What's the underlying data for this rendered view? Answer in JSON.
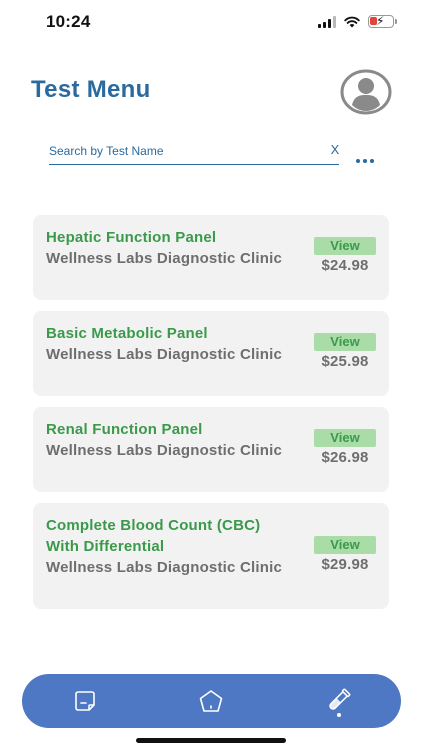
{
  "status_bar": {
    "time": "10:24",
    "icons": [
      "cellular-signal-icon",
      "wifi-icon",
      "battery-low-charging-icon"
    ],
    "battery_color": "#e0453a"
  },
  "header": {
    "title": "Test Menu",
    "avatar_icon": "user-avatar-icon"
  },
  "search": {
    "placeholder": "Search by Test Name",
    "value": "",
    "clear_label": "X",
    "more_icon": "more-dots-icon"
  },
  "tests": [
    {
      "name": "Hepatic Function Panel",
      "clinic": "Wellness Labs Diagnostic Clinic",
      "view_label": "View",
      "price": "$24.98"
    },
    {
      "name": "Basic Metabolic Panel",
      "clinic": "Wellness Labs Diagnostic Clinic",
      "view_label": "View",
      "price": "$25.98"
    },
    {
      "name": "Renal Function Panel",
      "clinic": "Wellness Labs Diagnostic Clinic",
      "view_label": "View",
      "price": "$26.98"
    },
    {
      "name": "Complete Blood Count (CBC) With Differential",
      "clinic": "Wellness Labs Diagnostic Clinic",
      "view_label": "View",
      "price": "$29.98"
    }
  ],
  "bottom_nav": {
    "items": [
      {
        "icon": "chat-document-icon",
        "active": false
      },
      {
        "icon": "home-pentagon-icon",
        "active": false
      },
      {
        "icon": "test-tube-icon",
        "active": true
      }
    ]
  },
  "colors": {
    "title": "#2b6a9e",
    "test_name": "#3a9a4a",
    "view_badge_bg": "#a9dca6",
    "card_bg": "#f2f2f2",
    "nav_bg": "#4e78c4"
  }
}
